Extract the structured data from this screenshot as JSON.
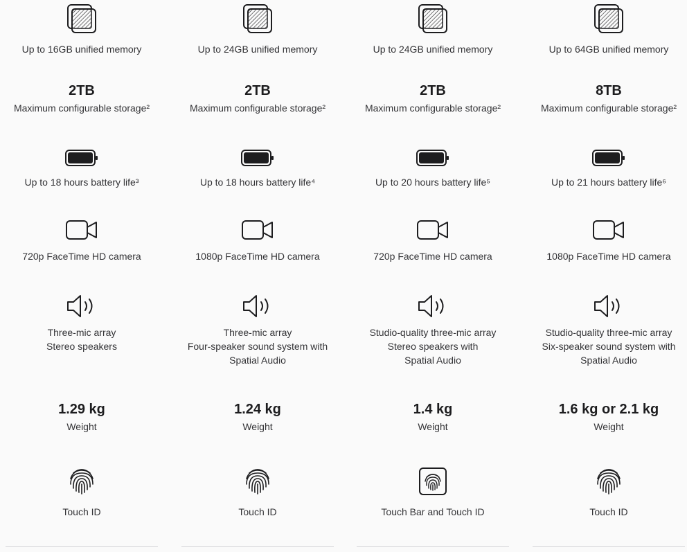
{
  "columns": [
    {
      "memory": "Up to 16GB unified memory",
      "storage_value": "2TB",
      "storage_label": "Maximum configurable storage²",
      "battery": "Up to 18 hours battery life³",
      "camera": "720p FaceTime HD camera",
      "audio": "Three-mic array\nStereo speakers",
      "weight_value": "1.29 kg",
      "weight_label": "Weight",
      "auth_icon": "fingerprint-icon",
      "auth": "Touch ID"
    },
    {
      "memory": "Up to 24GB unified memory",
      "storage_value": "2TB",
      "storage_label": "Maximum configurable storage²",
      "battery": "Up to 18 hours battery life⁴",
      "camera": "1080p FaceTime HD camera",
      "audio": "Three-mic array\nFour-speaker sound system with\nSpatial Audio",
      "weight_value": "1.24 kg",
      "weight_label": "Weight",
      "auth_icon": "fingerprint-icon",
      "auth": "Touch ID"
    },
    {
      "memory": "Up to 24GB unified memory",
      "storage_value": "2TB",
      "storage_label": "Maximum configurable storage²",
      "battery": "Up to 20 hours battery life⁵",
      "camera": "720p FaceTime HD camera",
      "audio": "Studio-quality three-mic array\nStereo speakers with\nSpatial Audio",
      "weight_value": "1.4 kg",
      "weight_label": "Weight",
      "auth_icon": "touch-bar-icon",
      "auth": "Touch Bar and Touch ID"
    },
    {
      "memory": "Up to 64GB unified memory",
      "storage_value": "8TB",
      "storage_label": "Maximum configurable storage²",
      "battery": "Up to 21 hours battery life⁶",
      "camera": "1080p FaceTime HD camera",
      "audio": "Studio-quality three-mic array\nSix-speaker sound system with\nSpatial Audio",
      "weight_value": "1.6 kg or 2.1 kg",
      "weight_label": "Weight",
      "auth_icon": "fingerprint-icon",
      "auth": "Touch ID"
    }
  ],
  "icons": {
    "memory": "memory-chip-icon",
    "battery": "battery-icon",
    "camera": "camera-icon",
    "audio": "speaker-icon"
  }
}
